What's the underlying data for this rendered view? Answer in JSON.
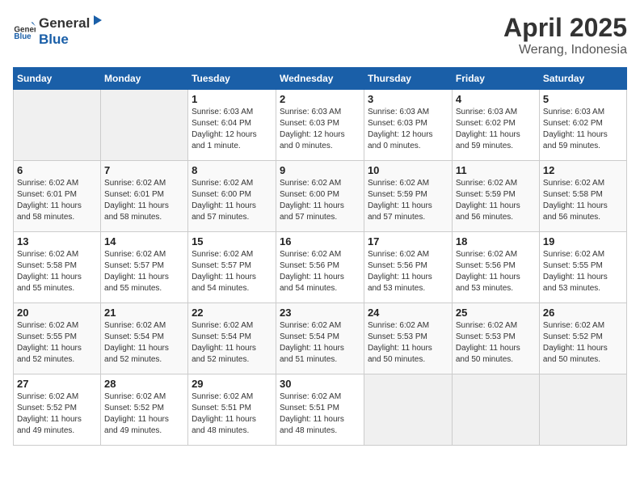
{
  "header": {
    "logo_general": "General",
    "logo_blue": "Blue",
    "month_year": "April 2025",
    "location": "Werang, Indonesia"
  },
  "weekdays": [
    "Sunday",
    "Monday",
    "Tuesday",
    "Wednesday",
    "Thursday",
    "Friday",
    "Saturday"
  ],
  "weeks": [
    [
      {
        "day": "",
        "info": ""
      },
      {
        "day": "",
        "info": ""
      },
      {
        "day": "1",
        "info": "Sunrise: 6:03 AM\nSunset: 6:04 PM\nDaylight: 12 hours\nand 1 minute."
      },
      {
        "day": "2",
        "info": "Sunrise: 6:03 AM\nSunset: 6:03 PM\nDaylight: 12 hours\nand 0 minutes."
      },
      {
        "day": "3",
        "info": "Sunrise: 6:03 AM\nSunset: 6:03 PM\nDaylight: 12 hours\nand 0 minutes."
      },
      {
        "day": "4",
        "info": "Sunrise: 6:03 AM\nSunset: 6:02 PM\nDaylight: 11 hours\nand 59 minutes."
      },
      {
        "day": "5",
        "info": "Sunrise: 6:03 AM\nSunset: 6:02 PM\nDaylight: 11 hours\nand 59 minutes."
      }
    ],
    [
      {
        "day": "6",
        "info": "Sunrise: 6:02 AM\nSunset: 6:01 PM\nDaylight: 11 hours\nand 58 minutes."
      },
      {
        "day": "7",
        "info": "Sunrise: 6:02 AM\nSunset: 6:01 PM\nDaylight: 11 hours\nand 58 minutes."
      },
      {
        "day": "8",
        "info": "Sunrise: 6:02 AM\nSunset: 6:00 PM\nDaylight: 11 hours\nand 57 minutes."
      },
      {
        "day": "9",
        "info": "Sunrise: 6:02 AM\nSunset: 6:00 PM\nDaylight: 11 hours\nand 57 minutes."
      },
      {
        "day": "10",
        "info": "Sunrise: 6:02 AM\nSunset: 5:59 PM\nDaylight: 11 hours\nand 57 minutes."
      },
      {
        "day": "11",
        "info": "Sunrise: 6:02 AM\nSunset: 5:59 PM\nDaylight: 11 hours\nand 56 minutes."
      },
      {
        "day": "12",
        "info": "Sunrise: 6:02 AM\nSunset: 5:58 PM\nDaylight: 11 hours\nand 56 minutes."
      }
    ],
    [
      {
        "day": "13",
        "info": "Sunrise: 6:02 AM\nSunset: 5:58 PM\nDaylight: 11 hours\nand 55 minutes."
      },
      {
        "day": "14",
        "info": "Sunrise: 6:02 AM\nSunset: 5:57 PM\nDaylight: 11 hours\nand 55 minutes."
      },
      {
        "day": "15",
        "info": "Sunrise: 6:02 AM\nSunset: 5:57 PM\nDaylight: 11 hours\nand 54 minutes."
      },
      {
        "day": "16",
        "info": "Sunrise: 6:02 AM\nSunset: 5:56 PM\nDaylight: 11 hours\nand 54 minutes."
      },
      {
        "day": "17",
        "info": "Sunrise: 6:02 AM\nSunset: 5:56 PM\nDaylight: 11 hours\nand 53 minutes."
      },
      {
        "day": "18",
        "info": "Sunrise: 6:02 AM\nSunset: 5:56 PM\nDaylight: 11 hours\nand 53 minutes."
      },
      {
        "day": "19",
        "info": "Sunrise: 6:02 AM\nSunset: 5:55 PM\nDaylight: 11 hours\nand 53 minutes."
      }
    ],
    [
      {
        "day": "20",
        "info": "Sunrise: 6:02 AM\nSunset: 5:55 PM\nDaylight: 11 hours\nand 52 minutes."
      },
      {
        "day": "21",
        "info": "Sunrise: 6:02 AM\nSunset: 5:54 PM\nDaylight: 11 hours\nand 52 minutes."
      },
      {
        "day": "22",
        "info": "Sunrise: 6:02 AM\nSunset: 5:54 PM\nDaylight: 11 hours\nand 52 minutes."
      },
      {
        "day": "23",
        "info": "Sunrise: 6:02 AM\nSunset: 5:54 PM\nDaylight: 11 hours\nand 51 minutes."
      },
      {
        "day": "24",
        "info": "Sunrise: 6:02 AM\nSunset: 5:53 PM\nDaylight: 11 hours\nand 50 minutes."
      },
      {
        "day": "25",
        "info": "Sunrise: 6:02 AM\nSunset: 5:53 PM\nDaylight: 11 hours\nand 50 minutes."
      },
      {
        "day": "26",
        "info": "Sunrise: 6:02 AM\nSunset: 5:52 PM\nDaylight: 11 hours\nand 50 minutes."
      }
    ],
    [
      {
        "day": "27",
        "info": "Sunrise: 6:02 AM\nSunset: 5:52 PM\nDaylight: 11 hours\nand 49 minutes."
      },
      {
        "day": "28",
        "info": "Sunrise: 6:02 AM\nSunset: 5:52 PM\nDaylight: 11 hours\nand 49 minutes."
      },
      {
        "day": "29",
        "info": "Sunrise: 6:02 AM\nSunset: 5:51 PM\nDaylight: 11 hours\nand 48 minutes."
      },
      {
        "day": "30",
        "info": "Sunrise: 6:02 AM\nSunset: 5:51 PM\nDaylight: 11 hours\nand 48 minutes."
      },
      {
        "day": "",
        "info": ""
      },
      {
        "day": "",
        "info": ""
      },
      {
        "day": "",
        "info": ""
      }
    ]
  ]
}
